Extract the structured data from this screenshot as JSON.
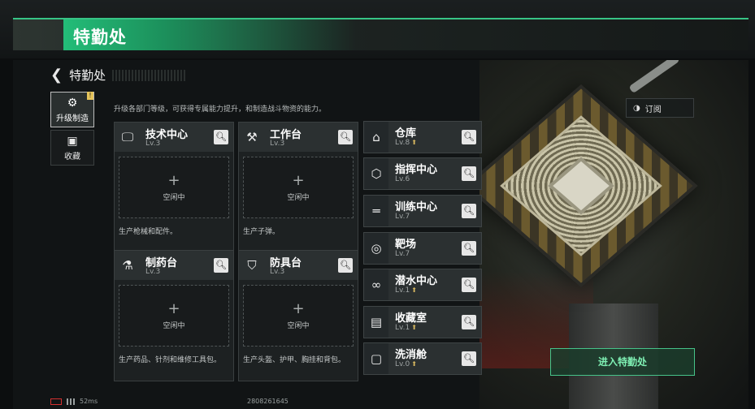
{
  "banner": {
    "title": "特勤处"
  },
  "header": {
    "back_title": "特勤处"
  },
  "tabs": [
    {
      "label": "升级制造",
      "icon": "upgrade-craft-icon",
      "active": true,
      "badge": "!"
    },
    {
      "label": "收藏",
      "icon": "collection-icon",
      "active": false
    }
  ],
  "description": "升级各部门等级，可获得专属能力提升，和制造战斗物资的能力。",
  "cards": [
    {
      "name": "技术中心",
      "level": "Lv.3",
      "icon": "monitor-icon",
      "status": "空闲中",
      "desc": "生产枪械和配件。"
    },
    {
      "name": "工作台",
      "level": "Lv.3",
      "icon": "tools-icon",
      "status": "空闲中",
      "desc": "生产子弹。"
    },
    {
      "name": "制药台",
      "level": "Lv.3",
      "icon": "microscope-icon",
      "status": "空闲中",
      "desc": "生产药品、针剂和维修工具包。"
    },
    {
      "name": "防具台",
      "level": "Lv.3",
      "icon": "armor-icon",
      "status": "空闲中",
      "desc": "生产头盔、护甲、胸挂和背包。"
    }
  ],
  "facilities": [
    {
      "name": "仓库",
      "level": "Lv.8",
      "icon": "warehouse-icon",
      "upgrade": true
    },
    {
      "name": "指挥中心",
      "level": "Lv.6",
      "icon": "chip-icon",
      "upgrade": false
    },
    {
      "name": "训练中心",
      "level": "Lv.7",
      "icon": "dumbbell-icon",
      "upgrade": false
    },
    {
      "name": "靶场",
      "level": "Lv.7",
      "icon": "target-icon",
      "upgrade": false
    },
    {
      "name": "潜水中心",
      "level": "Lv.1",
      "icon": "goggles-icon",
      "upgrade": true
    },
    {
      "name": "收藏室",
      "level": "Lv.1",
      "icon": "display-case-icon",
      "upgrade": true
    },
    {
      "name": "洗消舱",
      "level": "Lv.0",
      "icon": "decon-icon",
      "upgrade": true
    }
  ],
  "subscribe": {
    "label": "订阅"
  },
  "enter_button": {
    "label": "进入特勤处"
  },
  "status_bar": {
    "ping": "52ms",
    "uid": "2808261645"
  }
}
